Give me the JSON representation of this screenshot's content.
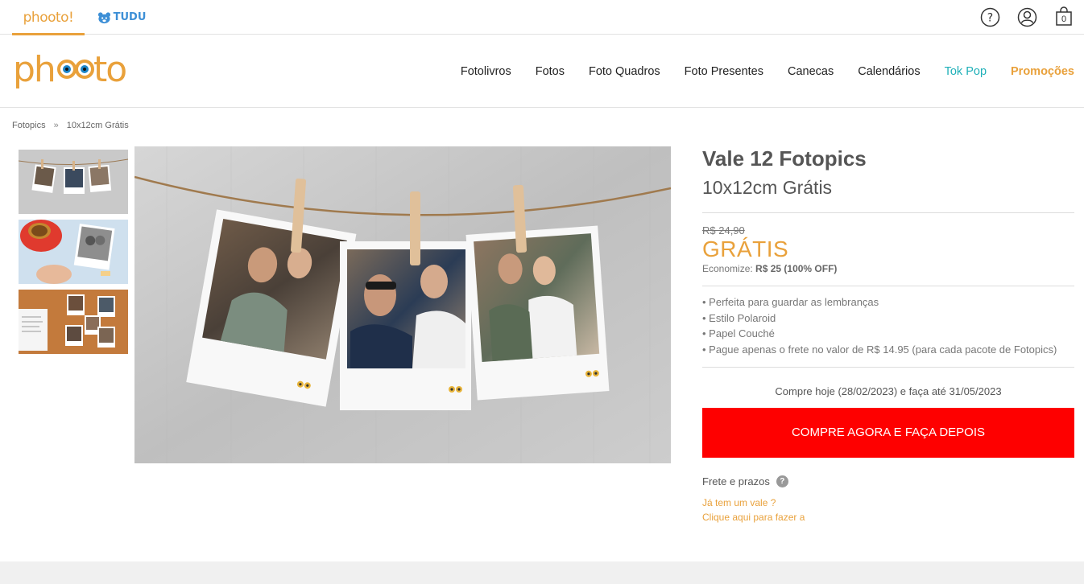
{
  "topbar": {
    "brands": [
      {
        "name": "phooto!",
        "active": true
      },
      {
        "name": "TUDU",
        "active": false
      }
    ],
    "cart_count": "0"
  },
  "header": {
    "logo_text": "phooto!",
    "nav": [
      "Fotolivros",
      "Fotos",
      "Foto Quadros",
      "Foto Presentes",
      "Canecas",
      "Calendários",
      "Tok Pop",
      "Promoções"
    ]
  },
  "breadcrumb": {
    "items": [
      "Fotopics",
      "10x12cm Grátis"
    ],
    "separator": "»"
  },
  "product": {
    "title": "Vale 12 Fotopics",
    "subtitle": "10x12cm Grátis",
    "old_price": "R$ 24,90",
    "price": "GRÁTIS",
    "economize_label": "Economize:",
    "economize_value": "R$ 25 (100% OFF)",
    "features": [
      "• Perfeita para guardar as lembranças",
      "• Estilo Polaroid",
      "• Papel Couché",
      "• Pague apenas o frete no valor de R$ 14.95 (para cada pacote de Fotopics)"
    ],
    "buy_note": "Compre hoje (28/02/2023) e faça até 31/05/2023",
    "cta_label": "COMPRE AGORA E FAÇA DEPOIS",
    "frete_label": "Frete e prazos",
    "vale_question": "Já tem um vale ?",
    "vale_link": "Clique aqui para fazer a"
  },
  "colors": {
    "brand_orange": "#e9a13b",
    "tokpop_teal": "#1fb0b8",
    "cta_red": "#fe0000",
    "tudu_blue": "#3d8fd6"
  },
  "icons": [
    "help-icon",
    "user-icon",
    "cart-icon",
    "question-icon"
  ]
}
